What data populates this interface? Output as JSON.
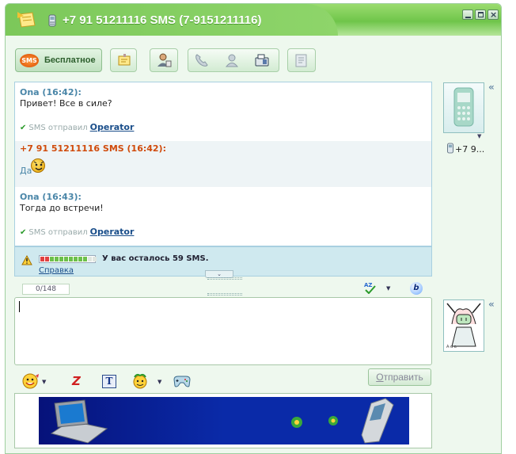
{
  "window": {
    "title": "+7 91 51211116 SMS (7-9151211116)",
    "accent_color": "#7cc85a"
  },
  "toolbar": {
    "free_sms_label": "Бесплатное",
    "sms_badge": "SMS",
    "icons": [
      "notes-icon",
      "contact-info-icon",
      "call-icon",
      "voice-icon",
      "fax-icon",
      "history-icon"
    ]
  },
  "chat": {
    "messages": [
      {
        "sender": "Ona (16:42):",
        "text": "Привет! Все в силе?",
        "status_prefix": "SMS отправил",
        "status_link": "Operator"
      },
      {
        "sender": "+7 91 51211116 SMS (16:42):",
        "text": "Да"
      },
      {
        "sender": "Ona (16:43):",
        "text": "Тогда до встречи!",
        "status_prefix": "SMS отправил",
        "status_link": "Operator"
      }
    ]
  },
  "info": {
    "remaining_text": "У вас осталось 59 SMS.",
    "help_link": "Справка",
    "remaining_fraction": 0.85
  },
  "compose": {
    "counter": "0/148",
    "value": "",
    "send_label": "Отправить",
    "send_label_first": "О",
    "send_label_rest": "тправить"
  },
  "sidebar": {
    "contact_label": "+7 9..."
  },
  "banner": {
    "colors": [
      "#06127a",
      "#0a2aa8"
    ]
  }
}
